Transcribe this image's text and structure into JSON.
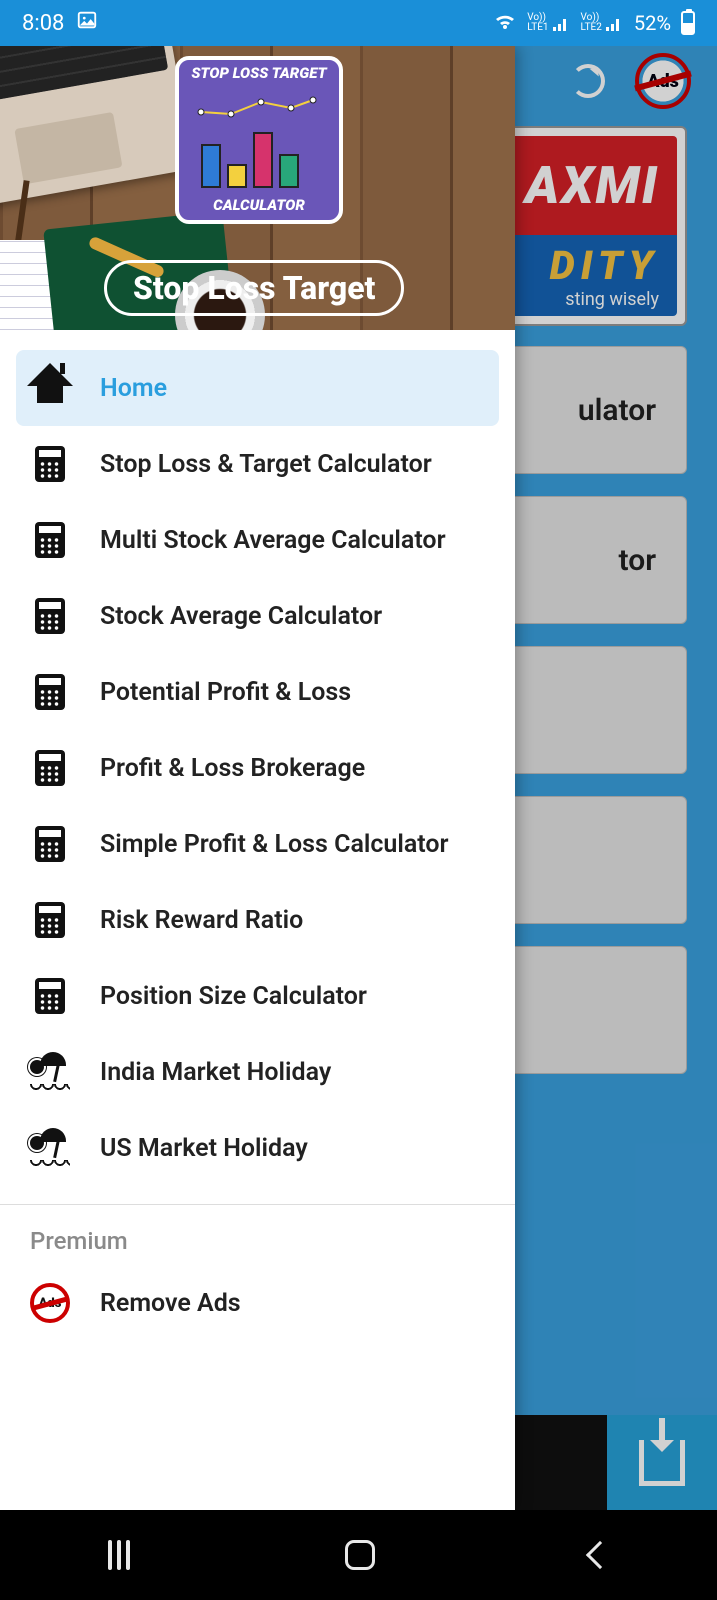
{
  "status": {
    "time": "8:08",
    "battery_pct": "52%",
    "lte1": "LTE1",
    "lte2": "LTE2"
  },
  "toolbar": {
    "no_ads_label": "Ads"
  },
  "brand": {
    "top": "AXMI",
    "sub": "DITY",
    "tag": "sting wisely"
  },
  "bg_tiles": [
    "ulator",
    "tor",
    "",
    "",
    ""
  ],
  "drawer": {
    "badge_top": "STOP LOSS TARGET",
    "badge_bottom": "CALCULATOR",
    "title": "Stop Loss Target"
  },
  "menu": [
    {
      "label": "Home",
      "icon": "home",
      "selected": true
    },
    {
      "label": "Stop Loss & Target Calculator",
      "icon": "calc"
    },
    {
      "label": "Multi Stock Average Calculator",
      "icon": "calc"
    },
    {
      "label": "Stock Average Calculator",
      "icon": "calc"
    },
    {
      "label": "Potential Profit & Loss",
      "icon": "calc"
    },
    {
      "label": "Profit & Loss Brokerage",
      "icon": "calc"
    },
    {
      "label": "Simple Profit & Loss Calculator",
      "icon": "calc"
    },
    {
      "label": "Risk Reward Ratio",
      "icon": "calc"
    },
    {
      "label": "Position Size Calculator",
      "icon": "calc"
    },
    {
      "label": "India Market Holiday",
      "icon": "beach"
    },
    {
      "label": "US Market Holiday",
      "icon": "beach"
    }
  ],
  "premium": {
    "title": "Premium",
    "remove_ads": "Remove Ads",
    "ads_badge": "Ads"
  }
}
